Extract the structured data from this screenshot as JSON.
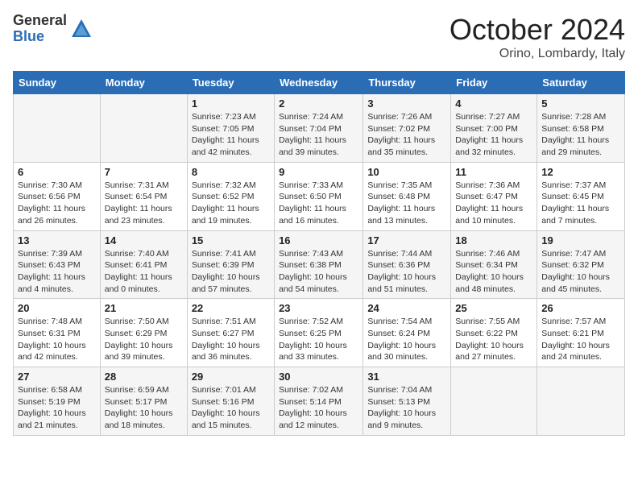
{
  "header": {
    "logo_general": "General",
    "logo_blue": "Blue",
    "title": "October 2024",
    "location": "Orino, Lombardy, Italy"
  },
  "days_of_week": [
    "Sunday",
    "Monday",
    "Tuesday",
    "Wednesday",
    "Thursday",
    "Friday",
    "Saturday"
  ],
  "weeks": [
    [
      {
        "day": "",
        "info": ""
      },
      {
        "day": "",
        "info": ""
      },
      {
        "day": "1",
        "info": "Sunrise: 7:23 AM\nSunset: 7:05 PM\nDaylight: 11 hours and 42 minutes."
      },
      {
        "day": "2",
        "info": "Sunrise: 7:24 AM\nSunset: 7:04 PM\nDaylight: 11 hours and 39 minutes."
      },
      {
        "day": "3",
        "info": "Sunrise: 7:26 AM\nSunset: 7:02 PM\nDaylight: 11 hours and 35 minutes."
      },
      {
        "day": "4",
        "info": "Sunrise: 7:27 AM\nSunset: 7:00 PM\nDaylight: 11 hours and 32 minutes."
      },
      {
        "day": "5",
        "info": "Sunrise: 7:28 AM\nSunset: 6:58 PM\nDaylight: 11 hours and 29 minutes."
      }
    ],
    [
      {
        "day": "6",
        "info": "Sunrise: 7:30 AM\nSunset: 6:56 PM\nDaylight: 11 hours and 26 minutes."
      },
      {
        "day": "7",
        "info": "Sunrise: 7:31 AM\nSunset: 6:54 PM\nDaylight: 11 hours and 23 minutes."
      },
      {
        "day": "8",
        "info": "Sunrise: 7:32 AM\nSunset: 6:52 PM\nDaylight: 11 hours and 19 minutes."
      },
      {
        "day": "9",
        "info": "Sunrise: 7:33 AM\nSunset: 6:50 PM\nDaylight: 11 hours and 16 minutes."
      },
      {
        "day": "10",
        "info": "Sunrise: 7:35 AM\nSunset: 6:48 PM\nDaylight: 11 hours and 13 minutes."
      },
      {
        "day": "11",
        "info": "Sunrise: 7:36 AM\nSunset: 6:47 PM\nDaylight: 11 hours and 10 minutes."
      },
      {
        "day": "12",
        "info": "Sunrise: 7:37 AM\nSunset: 6:45 PM\nDaylight: 11 hours and 7 minutes."
      }
    ],
    [
      {
        "day": "13",
        "info": "Sunrise: 7:39 AM\nSunset: 6:43 PM\nDaylight: 11 hours and 4 minutes."
      },
      {
        "day": "14",
        "info": "Sunrise: 7:40 AM\nSunset: 6:41 PM\nDaylight: 11 hours and 0 minutes."
      },
      {
        "day": "15",
        "info": "Sunrise: 7:41 AM\nSunset: 6:39 PM\nDaylight: 10 hours and 57 minutes."
      },
      {
        "day": "16",
        "info": "Sunrise: 7:43 AM\nSunset: 6:38 PM\nDaylight: 10 hours and 54 minutes."
      },
      {
        "day": "17",
        "info": "Sunrise: 7:44 AM\nSunset: 6:36 PM\nDaylight: 10 hours and 51 minutes."
      },
      {
        "day": "18",
        "info": "Sunrise: 7:46 AM\nSunset: 6:34 PM\nDaylight: 10 hours and 48 minutes."
      },
      {
        "day": "19",
        "info": "Sunrise: 7:47 AM\nSunset: 6:32 PM\nDaylight: 10 hours and 45 minutes."
      }
    ],
    [
      {
        "day": "20",
        "info": "Sunrise: 7:48 AM\nSunset: 6:31 PM\nDaylight: 10 hours and 42 minutes."
      },
      {
        "day": "21",
        "info": "Sunrise: 7:50 AM\nSunset: 6:29 PM\nDaylight: 10 hours and 39 minutes."
      },
      {
        "day": "22",
        "info": "Sunrise: 7:51 AM\nSunset: 6:27 PM\nDaylight: 10 hours and 36 minutes."
      },
      {
        "day": "23",
        "info": "Sunrise: 7:52 AM\nSunset: 6:25 PM\nDaylight: 10 hours and 33 minutes."
      },
      {
        "day": "24",
        "info": "Sunrise: 7:54 AM\nSunset: 6:24 PM\nDaylight: 10 hours and 30 minutes."
      },
      {
        "day": "25",
        "info": "Sunrise: 7:55 AM\nSunset: 6:22 PM\nDaylight: 10 hours and 27 minutes."
      },
      {
        "day": "26",
        "info": "Sunrise: 7:57 AM\nSunset: 6:21 PM\nDaylight: 10 hours and 24 minutes."
      }
    ],
    [
      {
        "day": "27",
        "info": "Sunrise: 6:58 AM\nSunset: 5:19 PM\nDaylight: 10 hours and 21 minutes."
      },
      {
        "day": "28",
        "info": "Sunrise: 6:59 AM\nSunset: 5:17 PM\nDaylight: 10 hours and 18 minutes."
      },
      {
        "day": "29",
        "info": "Sunrise: 7:01 AM\nSunset: 5:16 PM\nDaylight: 10 hours and 15 minutes."
      },
      {
        "day": "30",
        "info": "Sunrise: 7:02 AM\nSunset: 5:14 PM\nDaylight: 10 hours and 12 minutes."
      },
      {
        "day": "31",
        "info": "Sunrise: 7:04 AM\nSunset: 5:13 PM\nDaylight: 10 hours and 9 minutes."
      },
      {
        "day": "",
        "info": ""
      },
      {
        "day": "",
        "info": ""
      }
    ]
  ]
}
